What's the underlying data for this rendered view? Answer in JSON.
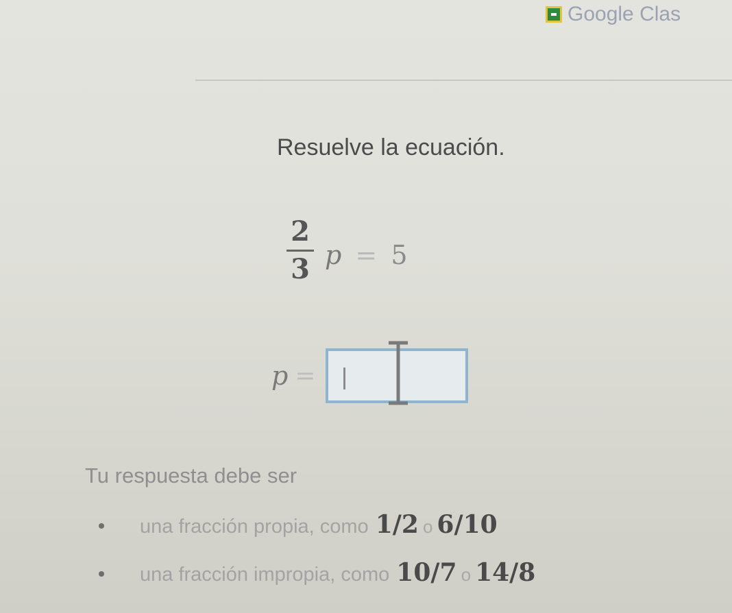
{
  "header": {
    "classroom_label": "Google Clas",
    "classroom_icon": "google-classroom-icon"
  },
  "exercise": {
    "prompt": "Resuelve la ecuación.",
    "equation": {
      "numerator": "2",
      "denominator": "3",
      "variable": "p",
      "equals": "=",
      "rhs": "5"
    },
    "answer": {
      "variable": "p",
      "equals": "=",
      "value": ""
    }
  },
  "hint": {
    "title": "Tu respuesta debe ser",
    "items": [
      {
        "text": "una fracción propia, como",
        "example_a": "1/2",
        "conj": "o",
        "example_b": "6/10"
      },
      {
        "text": "una fracción impropia, como",
        "example_a": "10/7",
        "conj": "o",
        "example_b": "14/8"
      }
    ]
  },
  "colors": {
    "input_border": "#8fb4cf",
    "classroom_green": "#2e8b3e",
    "classroom_yellow": "#e3c23e"
  }
}
